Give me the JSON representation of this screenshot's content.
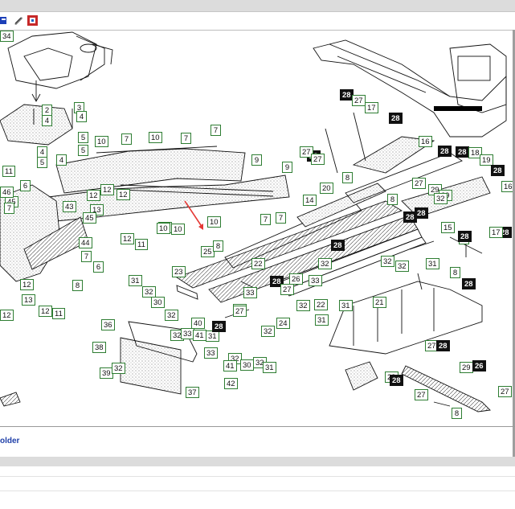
{
  "toolbar": {
    "icons": [
      "view-icon",
      "print-icon",
      "export-icon"
    ]
  },
  "footer": {
    "link_text": "older"
  },
  "arrow_color": "#e53935",
  "labels": [
    {
      "t": "2"
    },
    {
      "t": "3"
    },
    {
      "t": "4"
    },
    {
      "t": "4"
    },
    {
      "t": "4"
    },
    {
      "t": "5"
    },
    {
      "t": "5"
    },
    {
      "t": "4"
    },
    {
      "t": "10"
    },
    {
      "t": "5"
    },
    {
      "t": "7"
    },
    {
      "t": "10"
    },
    {
      "t": "7"
    },
    {
      "t": "7"
    },
    {
      "t": "9"
    },
    {
      "t": "11"
    },
    {
      "t": "6"
    },
    {
      "t": "45"
    },
    {
      "t": "46"
    },
    {
      "t": "7"
    },
    {
      "t": "43"
    },
    {
      "t": "12"
    },
    {
      "t": "13"
    },
    {
      "t": "12"
    },
    {
      "t": "45"
    },
    {
      "t": "12"
    },
    {
      "t": "9"
    },
    {
      "t": "10"
    },
    {
      "t": "10"
    },
    {
      "t": "7"
    },
    {
      "t": "7"
    },
    {
      "t": "44"
    },
    {
      "t": "12"
    },
    {
      "t": "11"
    },
    {
      "t": "10"
    },
    {
      "t": "10"
    },
    {
      "t": "7"
    },
    {
      "t": "6"
    },
    {
      "t": "12"
    },
    {
      "t": "13"
    },
    {
      "t": "8"
    },
    {
      "t": "12"
    },
    {
      "t": "11"
    },
    {
      "t": "12"
    },
    {
      "t": "25"
    },
    {
      "t": "23"
    },
    {
      "t": "31"
    },
    {
      "t": "32"
    },
    {
      "t": "30"
    },
    {
      "t": "32"
    },
    {
      "t": "32"
    },
    {
      "t": "40"
    },
    {
      "t": "33"
    },
    {
      "t": "41"
    },
    {
      "t": "31"
    },
    {
      "t": "28",
      "d": 1
    },
    {
      "t": "27"
    },
    {
      "t": "36"
    },
    {
      "t": "38"
    },
    {
      "t": "39"
    },
    {
      "t": "32"
    },
    {
      "t": "33"
    },
    {
      "t": "32"
    },
    {
      "t": "41"
    },
    {
      "t": "42"
    },
    {
      "t": "37"
    },
    {
      "t": "30"
    },
    {
      "t": "32"
    },
    {
      "t": "31"
    },
    {
      "t": "24"
    },
    {
      "t": "32"
    },
    {
      "t": "33"
    },
    {
      "t": "27"
    },
    {
      "t": "28",
      "d": 1
    },
    {
      "t": "27"
    },
    {
      "t": "26"
    },
    {
      "t": "8"
    },
    {
      "t": "22"
    },
    {
      "t": "32"
    },
    {
      "t": "22"
    },
    {
      "t": "31"
    },
    {
      "t": "31"
    },
    {
      "t": "21"
    },
    {
      "t": "32"
    },
    {
      "t": "32"
    },
    {
      "t": "33"
    },
    {
      "t": "28",
      "d": 1
    },
    {
      "t": "32"
    },
    {
      "t": "31"
    },
    {
      "t": "6"
    },
    {
      "t": "28",
      "d": 1
    },
    {
      "t": "27"
    },
    {
      "t": "17"
    },
    {
      "t": "28",
      "d": 1
    },
    {
      "t": "27"
    },
    {
      "t": "27"
    },
    {
      "t": "28",
      "d": 1
    },
    {
      "t": "16"
    },
    {
      "t": "14"
    },
    {
      "t": "20"
    },
    {
      "t": "8"
    },
    {
      "t": "8"
    },
    {
      "t": "28",
      "d": 1
    },
    {
      "t": "28",
      "d": 1
    },
    {
      "t": "18"
    },
    {
      "t": "19"
    },
    {
      "t": "28",
      "d": 1
    },
    {
      "t": "27"
    },
    {
      "t": "29"
    },
    {
      "t": "28",
      "d": 1
    },
    {
      "t": "29"
    },
    {
      "t": "32"
    },
    {
      "t": "28",
      "d": 1
    },
    {
      "t": "15"
    },
    {
      "t": "16"
    },
    {
      "t": "28",
      "d": 1
    },
    {
      "t": "17"
    },
    {
      "t": "28",
      "d": 1
    },
    {
      "t": "8"
    },
    {
      "t": "28",
      "d": 1
    },
    {
      "t": "27"
    },
    {
      "t": "28",
      "d": 1
    },
    {
      "t": "29"
    },
    {
      "t": "26",
      "d": 1
    },
    {
      "t": "29"
    },
    {
      "t": "28",
      "d": 1
    },
    {
      "t": "27"
    },
    {
      "t": "8"
    },
    {
      "t": "27"
    },
    {
      "t": "28",
      "d": 1
    },
    {
      "t": "34"
    }
  ]
}
